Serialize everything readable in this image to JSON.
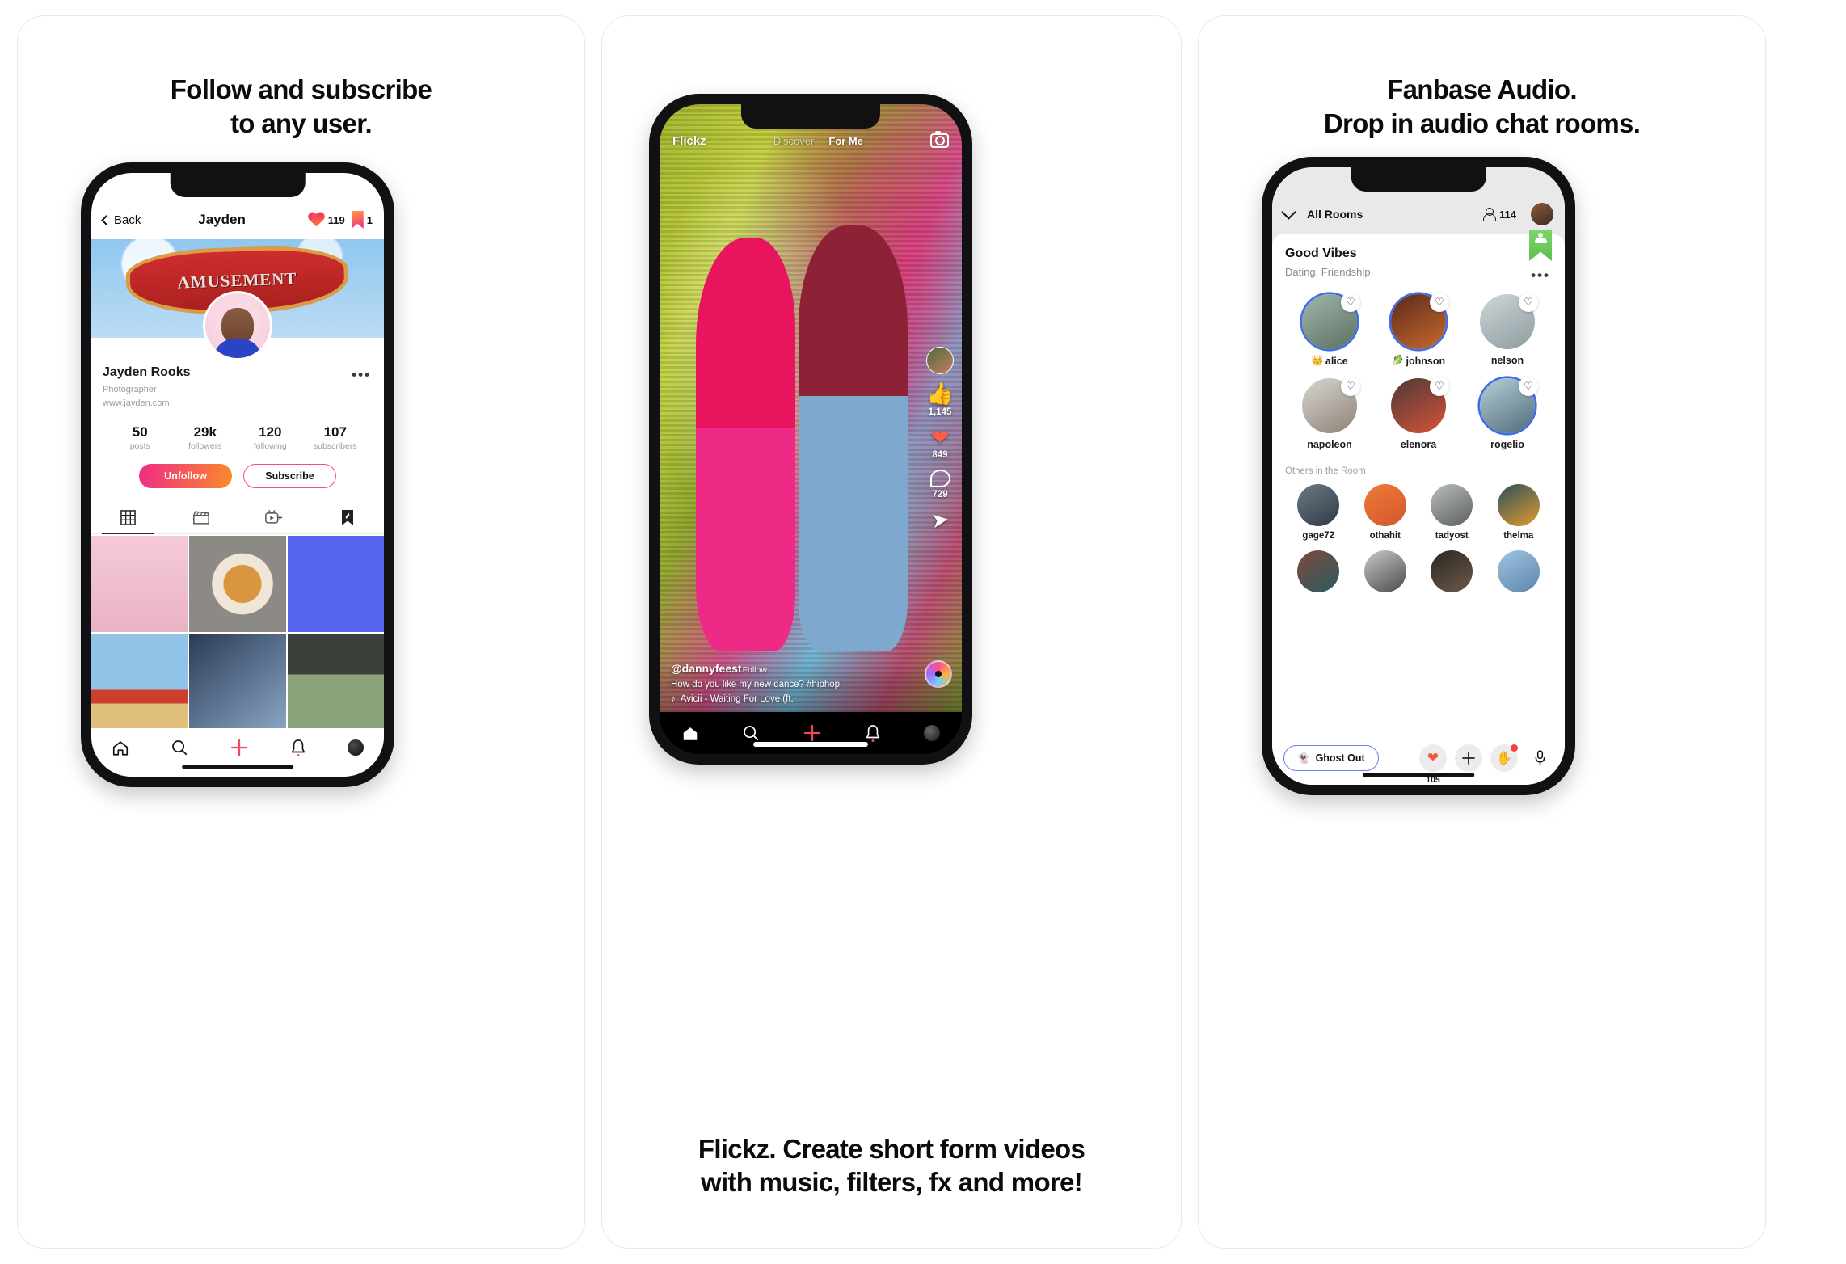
{
  "panels": {
    "left": {
      "headline_line1": "Follow and subscribe",
      "headline_line2": "to any user."
    },
    "middle": {
      "caption_line1": "Flickz. Create short form videos",
      "caption_line2": "with music, filters, fx and more!"
    },
    "right": {
      "headline_line1": "Fanbase Audio.",
      "headline_line2": "Drop in audio chat rooms."
    }
  },
  "profile_screen": {
    "back_label": "Back",
    "title": "Jayden",
    "likes_count": "119",
    "bookmarks_count": "1",
    "cover_text": "AMUSEMENT",
    "display_name": "Jayden Rooks",
    "bio_role": "Photographer",
    "bio_url": "www.jayden.com",
    "more_icon": "•••",
    "stats": [
      {
        "value": "50",
        "label": "posts"
      },
      {
        "value": "29k",
        "label": "followers"
      },
      {
        "value": "120",
        "label": "following"
      },
      {
        "value": "107",
        "label": "subscribers"
      }
    ],
    "unfollow_label": "Unfollow",
    "subscribe_label": "Subscribe",
    "tabs": [
      {
        "icon": "grid-icon",
        "active": true
      },
      {
        "icon": "clapperboard-icon",
        "active": false
      },
      {
        "icon": "tv-plus-icon",
        "active": false
      },
      {
        "icon": "bookmark-icon",
        "active": false
      }
    ],
    "grid_posts": [
      {
        "name": "portrait-pink",
        "color": "#f3c6d5"
      },
      {
        "name": "pizza-slice",
        "color": "#8d8a86"
      },
      {
        "name": "atlanta-graffiti",
        "color": "#5565f0"
      },
      {
        "name": "roller-coaster",
        "color": "#7fb4dd"
      },
      {
        "name": "street-portrait",
        "color": "#2a3b55"
      },
      {
        "name": "sneakers",
        "color": "#6f7b64"
      },
      {
        "name": "snow-scene",
        "color": "#cfdce6"
      },
      {
        "name": "dessert",
        "color": "#bfae99"
      },
      {
        "name": "smiley-pavement",
        "color": "#8b8a86"
      }
    ],
    "bottom_nav": [
      {
        "icon": "home-icon"
      },
      {
        "icon": "search-icon"
      },
      {
        "icon": "plus-icon"
      },
      {
        "icon": "bell-icon"
      },
      {
        "icon": "profile-avatar-icon"
      }
    ]
  },
  "flickz_screen": {
    "logo": "Flickz",
    "tab_discover": "Discover",
    "tab_for_me": "For Me",
    "camera_icon": "camera-icon",
    "rail": {
      "likes_thumb_count": "1,145",
      "hearts_count": "849",
      "comments_count": "729",
      "share_icon": "paper-plane-icon"
    },
    "username": "@dannyfeest",
    "follow_label": "Follow",
    "description": "How do you like my new dance? #hiphop",
    "music": "Avicii - Waiting For Love (ft.",
    "more_icon": "•••",
    "bottom_nav": [
      {
        "icon": "home-icon"
      },
      {
        "icon": "search-icon"
      },
      {
        "icon": "plus-icon"
      },
      {
        "icon": "bell-icon"
      },
      {
        "icon": "profile-avatar-icon"
      }
    ]
  },
  "audio_room_screen": {
    "collapse_icon": "chevron-down-icon",
    "all_rooms_label": "All Rooms",
    "people_count": "114",
    "room_title": "Good Vibes",
    "room_tags": "Dating, Friendship",
    "more_icon": "•••",
    "ribbon_icon": "group-icon",
    "speakers": [
      {
        "name": "alice",
        "badge": "👑",
        "speaking": true,
        "av": "linear-gradient(150deg,#9fb8aa,#5c6f63)"
      },
      {
        "name": "johnson",
        "badge": "🥬",
        "speaking": true,
        "av": "linear-gradient(150deg,#5a2a1c,#c86a2c)"
      },
      {
        "name": "nelson",
        "badge": "",
        "speaking": false,
        "av": "linear-gradient(150deg,#cfd6d8,#8d9ba0)"
      },
      {
        "name": "napoleon",
        "badge": "",
        "speaking": false,
        "av": "linear-gradient(150deg,#d8d6d2,#8d8276)"
      },
      {
        "name": "elenora",
        "badge": "",
        "speaking": false,
        "av": "linear-gradient(150deg,#4a3a36,#d9523a)"
      },
      {
        "name": "rogelio",
        "badge": "",
        "speaking": true,
        "av": "linear-gradient(150deg,#b7cfd8,#4f6c7a)"
      }
    ],
    "like_icon": "heart-outline-icon",
    "others_label": "Others in the Room",
    "others": [
      {
        "name": "gage72",
        "av": "linear-gradient(150deg,#6d7a86,#2f3a44)"
      },
      {
        "name": "othahit",
        "av": "linear-gradient(150deg,#ef7a3a,#d4572a)"
      },
      {
        "name": "tadyost",
        "av": "linear-gradient(150deg,#b9bdbb,#5d6063)"
      },
      {
        "name": "thelma",
        "av": "linear-gradient(150deg,#2d4f5c,#e09b2d)"
      },
      {
        "name": "",
        "av": "linear-gradient(150deg,#7c4a3a,#2c5a62)"
      },
      {
        "name": "",
        "av": "linear-gradient(150deg,#c9c9c9,#4a4a4a)"
      },
      {
        "name": "",
        "av": "linear-gradient(150deg,#2a2623,#6d5a4a)"
      },
      {
        "name": "",
        "av": "linear-gradient(150deg,#9fc4e0,#5d86ad)"
      }
    ],
    "ghost_out_label": "Ghost Out",
    "ghost_icon": "👻",
    "reaction_heart_count": "105",
    "add_icon": "plus-icon",
    "raise_hand_icon": "✋",
    "mic_icon": "microphone-icon"
  },
  "colors": {
    "accent_pink": "#ef2b86",
    "accent_orange": "#fb8a2a",
    "speaking_ring": "#3f6fe8",
    "ribbon_green": "#5cc04f",
    "plus_red": "#f04a5a"
  }
}
